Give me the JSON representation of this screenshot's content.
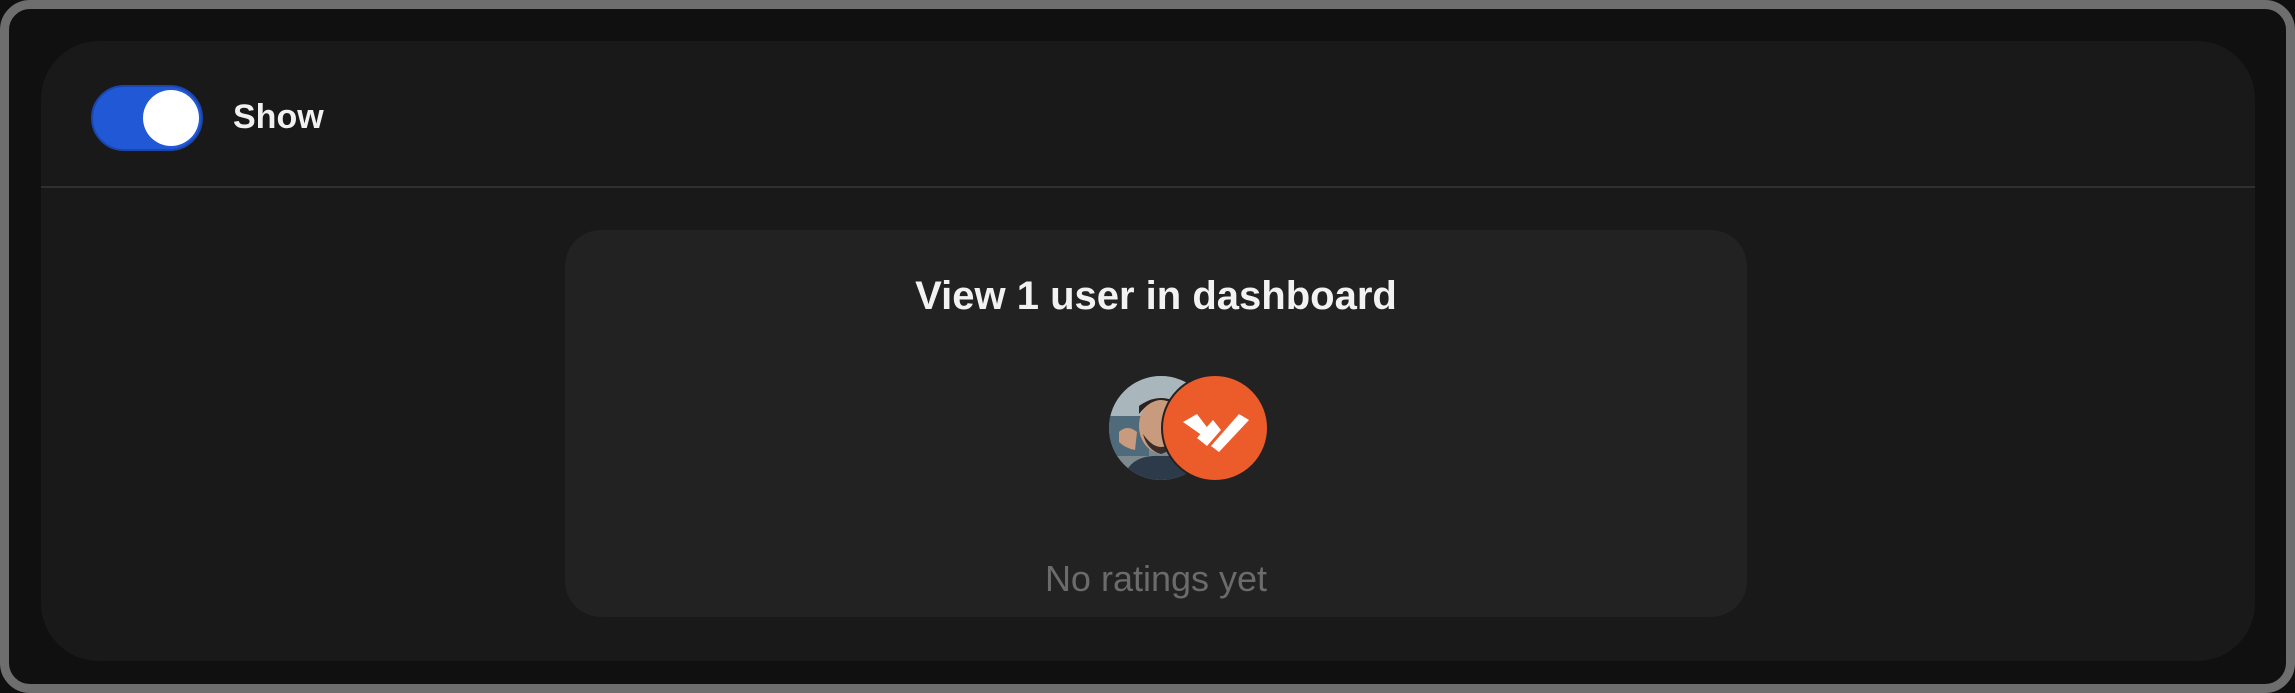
{
  "toggle": {
    "label": "Show",
    "state": "on",
    "accent_color": "#2158d6"
  },
  "card": {
    "title": "View 1 user in dashboard",
    "empty_text": "No ratings yet",
    "avatars": [
      {
        "kind": "user-photo",
        "icon": "user-avatar"
      },
      {
        "kind": "brand-logo",
        "icon": "brand-logo-icon",
        "color": "#ec5b2a"
      }
    ]
  }
}
